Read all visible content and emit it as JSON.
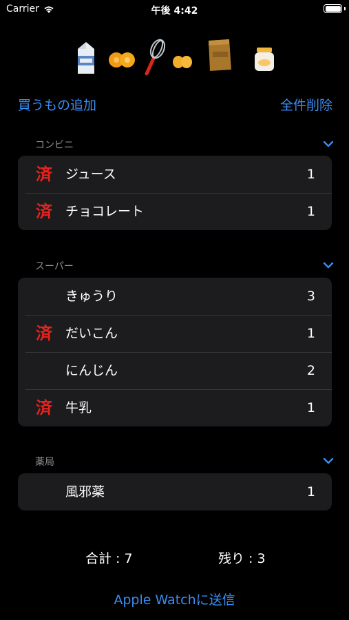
{
  "status": {
    "carrier": "Carrier",
    "time": "午後 4:42"
  },
  "header": {
    "add_label": "買うもの追加",
    "delete_all_label": "全件削除"
  },
  "illustrations": [
    "milk-carton-icon",
    "oranges-icon",
    "whisk-icon",
    "eggs-icon",
    "flour-bag-icon",
    "jar-icon"
  ],
  "sections": [
    {
      "title": "コンビニ",
      "items": [
        {
          "done": true,
          "name": "ジュース",
          "qty": "1"
        },
        {
          "done": true,
          "name": "チョコレート",
          "qty": "1"
        }
      ]
    },
    {
      "title": "スーパー",
      "items": [
        {
          "done": false,
          "name": "きゅうり",
          "qty": "3"
        },
        {
          "done": true,
          "name": "だいこん",
          "qty": "1"
        },
        {
          "done": false,
          "name": "にんじん",
          "qty": "2"
        },
        {
          "done": true,
          "name": "牛乳",
          "qty": "1"
        }
      ]
    },
    {
      "title": "薬局",
      "items": [
        {
          "done": false,
          "name": "風邪薬",
          "qty": "1"
        }
      ]
    }
  ],
  "done_mark": "済",
  "footer": {
    "total_label": "合計 : 7",
    "remaining_label": "残り : 3",
    "send_label": "Apple Watchに送信"
  },
  "colors": {
    "accent": "#3a8df5",
    "done_mark": "#e8221d",
    "card": "#1c1c1e",
    "section_title": "#8e8e93"
  }
}
